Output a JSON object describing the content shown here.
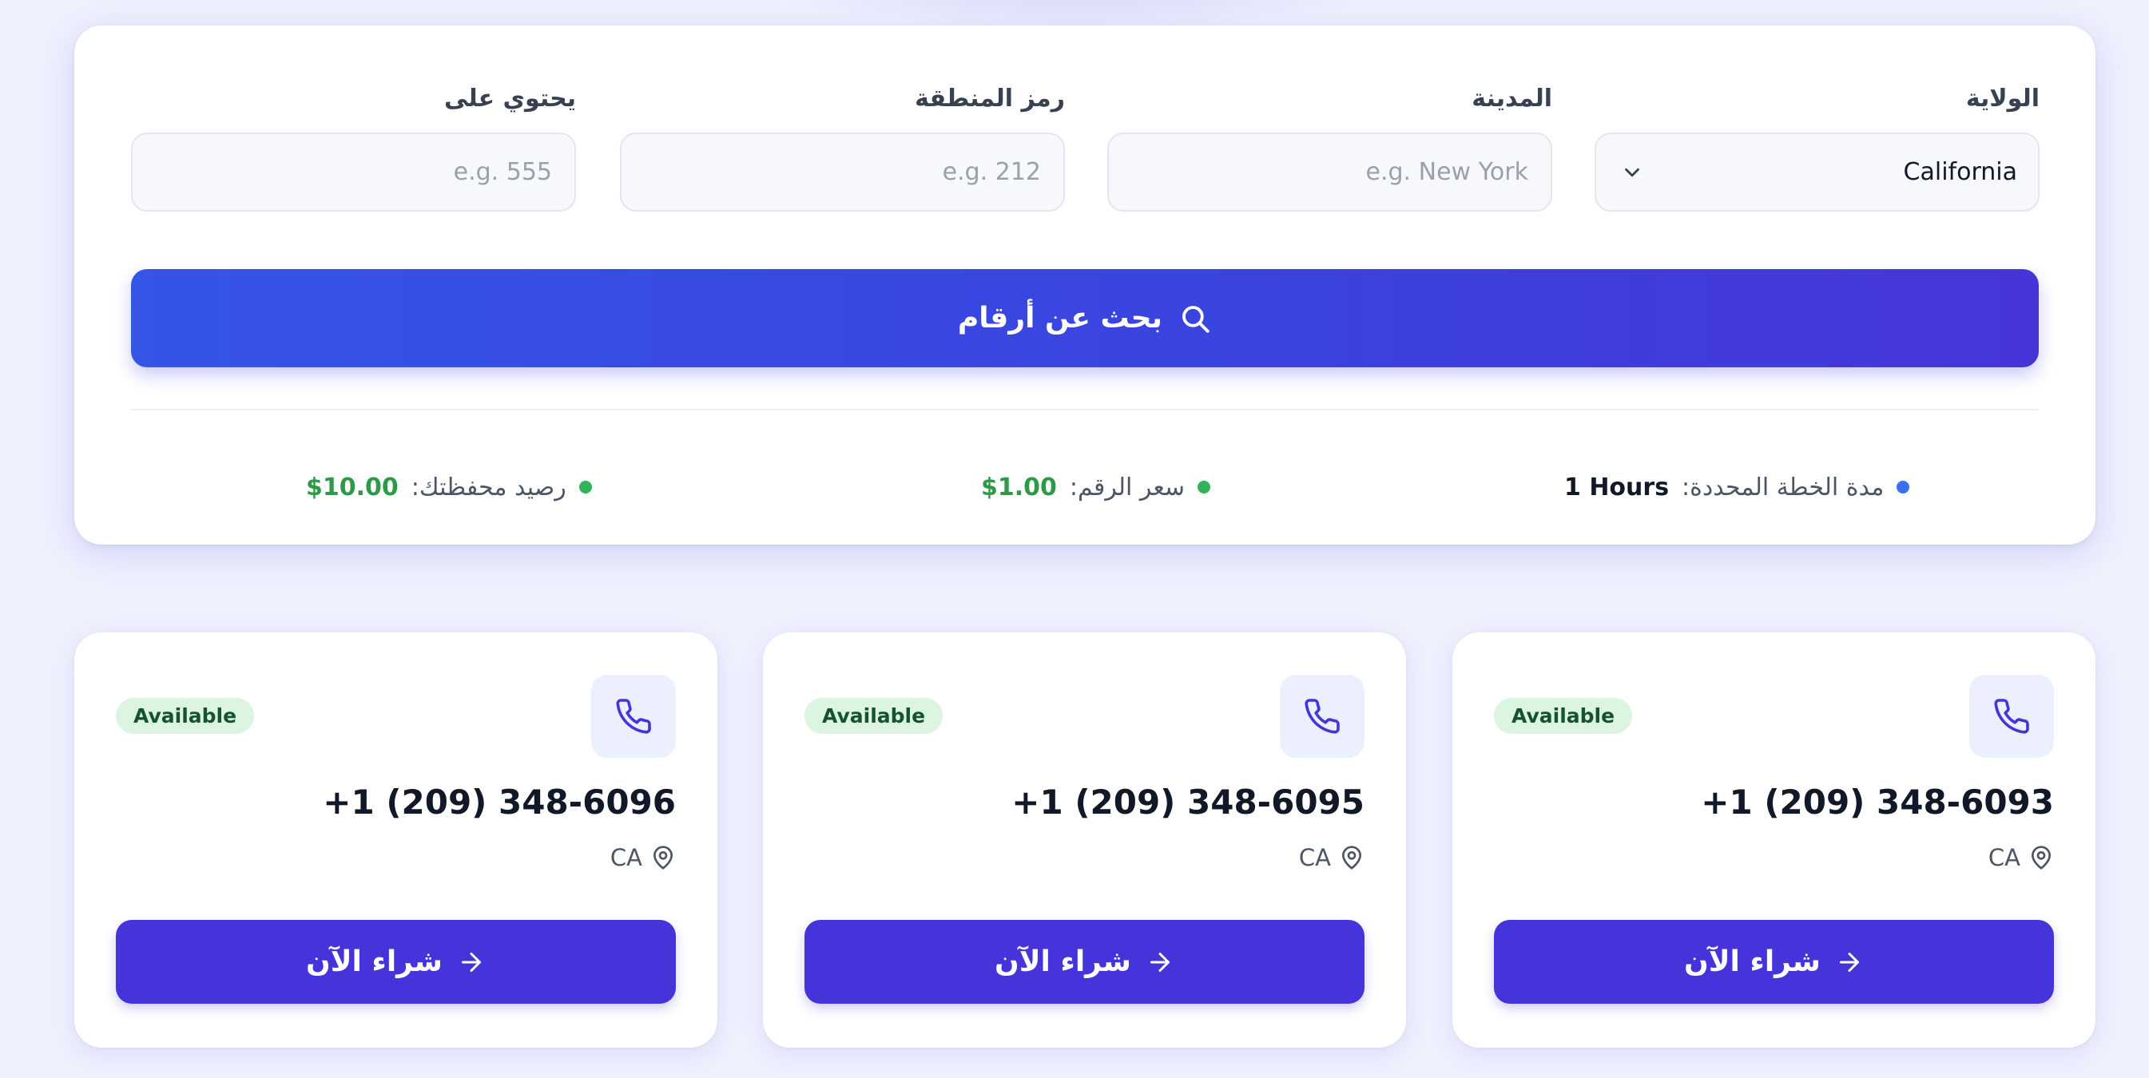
{
  "filters": {
    "state": {
      "label": "الولاية",
      "value": "California"
    },
    "city": {
      "label": "المدينة",
      "placeholder": "e.g. New York"
    },
    "area_code": {
      "label": "رمز المنطقة",
      "placeholder": "e.g. 212"
    },
    "contains": {
      "label": "يحتوي على",
      "placeholder": "e.g. 555"
    }
  },
  "search_button": {
    "label": "بحث عن أرقام",
    "icon": "search-icon"
  },
  "info": {
    "plan": {
      "label": "مدة الخطة المحددة:",
      "value": "1 Hours",
      "dot_color": "#3b6ff0"
    },
    "price": {
      "label": "سعر الرقم:",
      "value": "$1.00",
      "dot_color": "#34b25a"
    },
    "balance": {
      "label": "رصيد محفظتك:",
      "value": "$10.00",
      "dot_color": "#34b25a"
    }
  },
  "cards": [
    {
      "number": "+1 (209) 348-6093",
      "location": "CA",
      "status": "Available",
      "buy_label": "شراء الآن"
    },
    {
      "number": "+1 (209) 348-6095",
      "location": "CA",
      "status": "Available",
      "buy_label": "شراء الآن"
    },
    {
      "number": "+1 (209) 348-6096",
      "location": "CA",
      "status": "Available",
      "buy_label": "شراء الآن"
    }
  ],
  "colors": {
    "accent": "#4434d9",
    "gradient_start": "#3555e6",
    "gradient_end": "#4636d8",
    "available_badge_bg": "#dcf5e1",
    "price_green": "#2e9a47"
  }
}
